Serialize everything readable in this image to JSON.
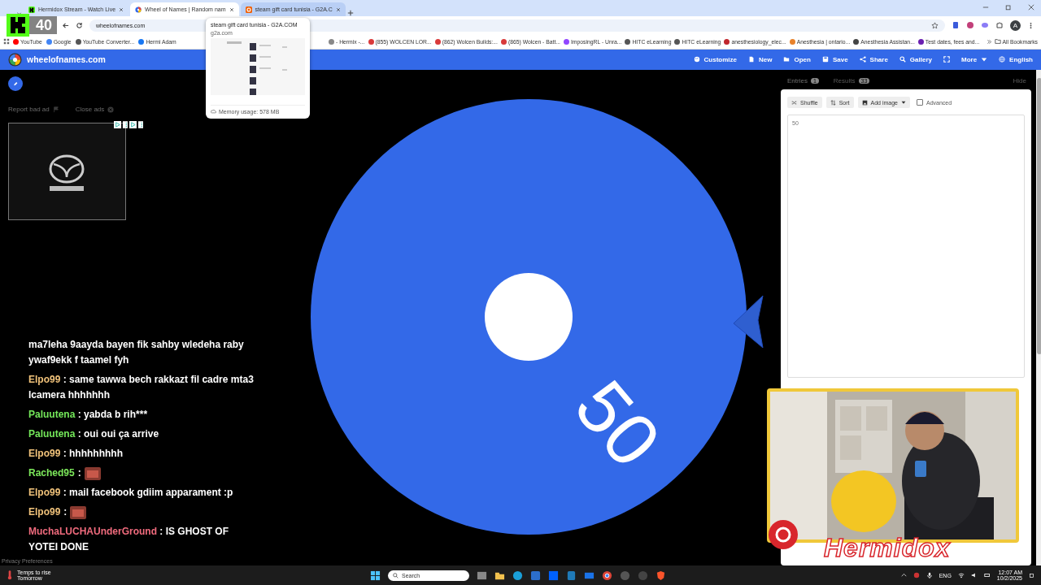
{
  "stream_badge": {
    "count": "40"
  },
  "browser": {
    "tabs": [
      {
        "title": "Hermidox Stream - Watch Live",
        "selected": false
      },
      {
        "title": "Wheel of Names | Random nam",
        "selected": true
      },
      {
        "title": "steam gift card tunisia - G2A.C",
        "selected": false
      }
    ],
    "hover_card": {
      "title": "steam gift card tunisia - G2A.COM",
      "domain": "g2a.com",
      "memory": "Memory usage: 578 MB"
    },
    "address": "wheelofnames.com",
    "profile_initial": "A",
    "bookmarks": [
      {
        "label": "YouTube",
        "color": "#ff0000"
      },
      {
        "label": "Google",
        "color": "#4285f4"
      },
      {
        "label": "YouTube Converter...",
        "color": "#555555"
      },
      {
        "label": "Hermi Adam",
        "color": "#1877f2"
      },
      {
        "label": "- Hermix -...",
        "color": "#888888"
      },
      {
        "label": "(855) WOLCEN LOR...",
        "color": "#d93a3a"
      },
      {
        "label": "(862) Wolcen Builds:...",
        "color": "#d93a3a"
      },
      {
        "label": "(865) Wolcen - Batt...",
        "color": "#d93a3a"
      },
      {
        "label": "ImposingRL - Unra...",
        "color": "#9146ff"
      },
      {
        "label": "HITC eLearning",
        "color": "#555555"
      },
      {
        "label": "HITC eLearning",
        "color": "#555555"
      },
      {
        "label": "anesthesiology_elec...",
        "color": "#c0262d"
      },
      {
        "label": "Anesthesia | ontario...",
        "color": "#e8822a"
      },
      {
        "label": "Anesthesia Assistan...",
        "color": "#444444"
      },
      {
        "label": "Test dates, fees and...",
        "color": "#6a1fb0"
      }
    ],
    "all_bookmarks": "All Bookmarks"
  },
  "app": {
    "logo_text": "wheelofnames.com",
    "menu": [
      {
        "kind": "customize",
        "label": "Customize"
      },
      {
        "kind": "new",
        "label": "New"
      },
      {
        "kind": "open",
        "label": "Open"
      },
      {
        "kind": "save",
        "label": "Save"
      },
      {
        "kind": "share",
        "label": "Share"
      },
      {
        "kind": "gallery",
        "label": "Gallery"
      },
      {
        "kind": "fullscreen"
      },
      {
        "kind": "more",
        "label": "More"
      },
      {
        "kind": "language",
        "label": "English"
      }
    ]
  },
  "ad": {
    "report": "Report bad ad",
    "close": "Close ads"
  },
  "wheel": {
    "segments": [
      {
        "label": "50",
        "color": "#3369e8"
      }
    ]
  },
  "panel": {
    "tabs": [
      {
        "label": "Entries",
        "count": "1",
        "selected": true
      },
      {
        "label": "Results",
        "count": "33",
        "selected": false
      }
    ],
    "hide": "Hide",
    "tools": [
      {
        "kind": "shuffle",
        "label": "Shuffle"
      },
      {
        "kind": "sort",
        "label": "Sort"
      },
      {
        "kind": "add_image",
        "label": "Add image"
      }
    ],
    "advanced": {
      "label": "Advanced",
      "checked": false
    },
    "entries_text": "50"
  },
  "chat": [
    {
      "kind": "text",
      "text": "ma7leha 9aayda bayen fik sahby wledeha raby ywaf9ekk f taamel fyh"
    },
    {
      "kind": "text",
      "user": "Elpo99",
      "separator": ":",
      "color": "#f0c27a",
      "text": "same tawwa bech rakkazt fil cadre mta3 lcamera hhhhhhh"
    },
    {
      "kind": "text",
      "user": "Paluutena",
      "separator": ":",
      "color": "#74e85a",
      "text": "yabda b rih***"
    },
    {
      "kind": "text",
      "user": "Paluutena",
      "separator": ":",
      "color": "#74e85a",
      "text": "oui oui ça arrive"
    },
    {
      "kind": "text",
      "user": "Elpo99",
      "separator": ":",
      "color": "#f0c27a",
      "text": "hhhhhhhhh"
    },
    {
      "kind": "emote",
      "user": "Rached95",
      "separator": ":",
      "color": "#7ce85b"
    },
    {
      "kind": "text",
      "user": "Elpo99",
      "separator": ":",
      "color": "#f0c27a",
      "text": "mail facebook gdiim apparament :p"
    },
    {
      "kind": "emote",
      "user": "Elpo99",
      "separator": ":",
      "color": "#f0c27a"
    },
    {
      "kind": "text",
      "user": "MuchaLUCHAUnderGround",
      "separator": ":",
      "color": "#f06b7d",
      "text": "IS GHOST OF YOTEI DONE"
    }
  ],
  "overlay_name": "Hermidox",
  "privacy": "Privacy Preferences",
  "taskbar": {
    "weather": {
      "title": "Temps to rise",
      "subtitle": "Tomorrow"
    },
    "search": "Search",
    "language": "ENG",
    "time": "12:07 AM",
    "date": "10/2/2025"
  }
}
